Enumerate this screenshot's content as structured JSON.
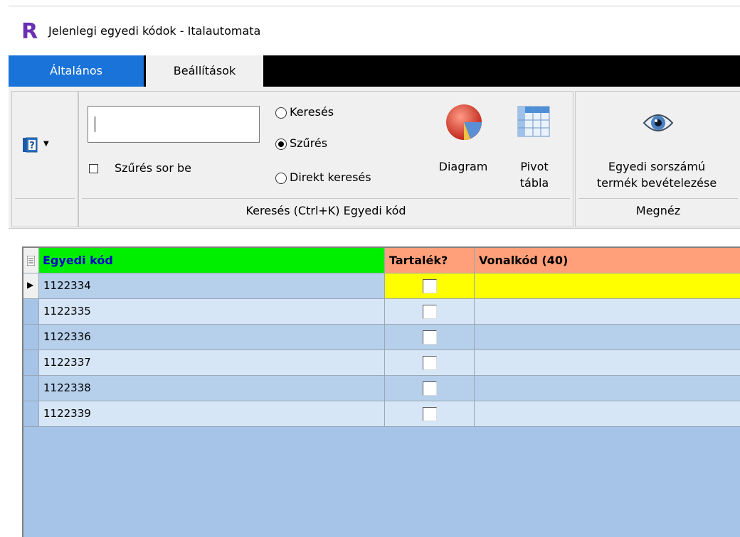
{
  "window": {
    "app_logo": "R",
    "title": "Jelenlegi egyedi kódok - Italautomata"
  },
  "tabs": [
    {
      "label": "Általános",
      "active": true
    },
    {
      "label": "Beállítások",
      "active": false
    }
  ],
  "ribbon": {
    "help": {
      "icon": "help-book-icon",
      "dropdown_icon": "caret-down-icon"
    },
    "search_group": {
      "search_value": "",
      "filter_row_label": "Szűrés sor be",
      "filter_row_checked": false,
      "modes": [
        {
          "label": "Keresés",
          "selected": false
        },
        {
          "label": "Szűrés",
          "selected": true
        },
        {
          "label": "Direkt keresés",
          "selected": false
        }
      ],
      "diagram_label": "Diagram",
      "pivot_label_line1": "Pivot",
      "pivot_label_line2": "tábla",
      "caption": "Keresés (Ctrl+K) Egyedi kód"
    },
    "view_group": {
      "button_line1": "Egyedi sorszámú",
      "button_line2": "termék bevételezése",
      "caption": "Megnéz"
    }
  },
  "grid": {
    "columns": [
      {
        "label": "Egyedi kód",
        "color": "#00ee00",
        "text_color": "#0000cc"
      },
      {
        "label": "Tartalék?",
        "color": "#ffa07a",
        "text_color": "#000000"
      },
      {
        "label": "Vonalkód (40)",
        "color": "#ffa07a",
        "text_color": "#000000"
      }
    ],
    "rows": [
      {
        "code": "1122334",
        "reserve": false,
        "barcode": "",
        "current": true
      },
      {
        "code": "1122335",
        "reserve": false,
        "barcode": "",
        "current": false
      },
      {
        "code": "1122336",
        "reserve": false,
        "barcode": "",
        "current": false
      },
      {
        "code": "1122337",
        "reserve": false,
        "barcode": "",
        "current": false
      },
      {
        "code": "1122338",
        "reserve": false,
        "barcode": "",
        "current": false
      },
      {
        "code": "1122339",
        "reserve": false,
        "barcode": "",
        "current": false
      }
    ]
  }
}
